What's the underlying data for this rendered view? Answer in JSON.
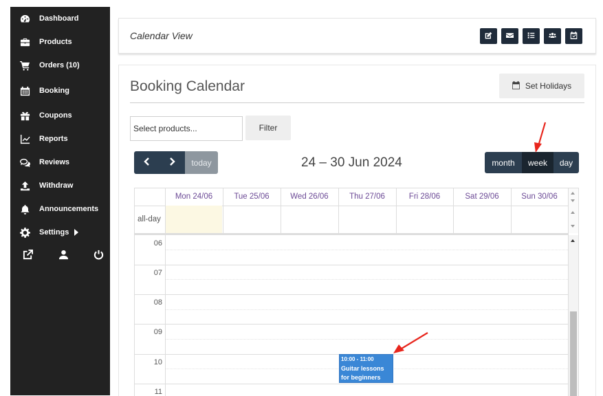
{
  "sidebar": {
    "items": [
      {
        "label": "Dashboard",
        "icon": "dashboard-icon"
      },
      {
        "label": "Products",
        "icon": "briefcase-icon"
      },
      {
        "label": "Orders (10)",
        "icon": "cart-icon"
      },
      {
        "label": "Booking",
        "icon": "calendar-icon"
      },
      {
        "label": "Coupons",
        "icon": "gift-icon"
      },
      {
        "label": "Reports",
        "icon": "chart-line-icon"
      },
      {
        "label": "Reviews",
        "icon": "comments-icon"
      },
      {
        "label": "Withdraw",
        "icon": "upload-icon"
      },
      {
        "label": "Announcements",
        "icon": "bell-icon"
      },
      {
        "label": "Settings",
        "icon": "gear-icon"
      }
    ],
    "bottom_icons": [
      "external-link-icon",
      "user-icon",
      "power-icon"
    ]
  },
  "header": {
    "title": "Calendar View",
    "buttons": [
      "edit-icon",
      "envelope-icon",
      "list-icon",
      "users-icon",
      "calendar-check-icon"
    ]
  },
  "booking": {
    "title": "Booking Calendar",
    "holidays_label": "Set Holidays",
    "product_select_placeholder": "Select products...",
    "filter_label": "Filter"
  },
  "calendar": {
    "today_label": "today",
    "range_title": "24 – 30 Jun 2024",
    "views": {
      "month": "month",
      "week": "week",
      "day": "day"
    },
    "active_view": "week",
    "days": [
      "Mon 24/06",
      "Tue 25/06",
      "Wed 26/06",
      "Thu 27/06",
      "Fri 28/06",
      "Sat 29/06",
      "Sun 30/06"
    ],
    "allday_label": "all-day",
    "hours": [
      "06",
      "07",
      "08",
      "09",
      "10",
      "11"
    ],
    "event": {
      "time": "10:00 - 11:00",
      "title": "Guitar lessons",
      "subtitle": "for beginners"
    }
  },
  "colors": {
    "sidebar_bg": "#222222",
    "dark_button": "#2c3e50",
    "active_view": "#1a252f",
    "event_bg": "#3a87d6",
    "today_bg": "#fcf8e3",
    "day_header_text": "#6c4a96",
    "annotation_arrow": "#e8261d"
  }
}
